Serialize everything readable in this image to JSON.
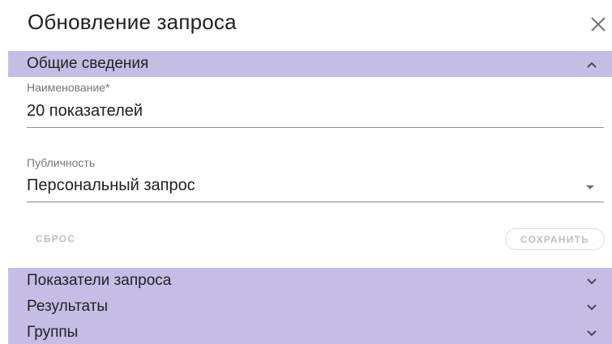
{
  "dialog": {
    "title": "Обновление запроса",
    "close_icon": "close-icon"
  },
  "sections": {
    "general": {
      "label": "Общие сведения",
      "state": "expanded"
    },
    "indicators": {
      "label": "Показатели запроса",
      "state": "collapsed"
    },
    "results": {
      "label": "Результаты",
      "state": "collapsed"
    },
    "groups": {
      "label": "Группы",
      "state": "collapsed"
    }
  },
  "form": {
    "name_label": "Наименование*",
    "name_value": "20 показателей",
    "publicity_label": "Публичность",
    "publicity_value": "Персональный запрос"
  },
  "actions": {
    "reset_label": "СБРОС",
    "save_label": "СОХРАНИТЬ"
  },
  "colors": {
    "section_header_bg": "#c5bde6",
    "text_primary": "#212121",
    "text_secondary": "#757575",
    "disabled_text": "#c0c0c0"
  }
}
